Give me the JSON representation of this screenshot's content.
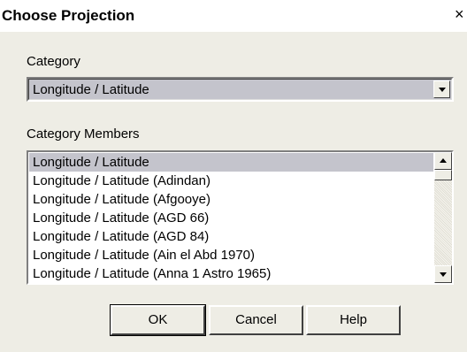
{
  "window": {
    "title": "Choose Projection",
    "close_label": "×"
  },
  "category": {
    "label": "Category",
    "selected_value": "Longitude / Latitude"
  },
  "members": {
    "label": "Category Members",
    "items": [
      "Longitude / Latitude",
      "Longitude / Latitude (Adindan)",
      "Longitude / Latitude (Afgooye)",
      "Longitude / Latitude (AGD 66)",
      "Longitude / Latitude (AGD 84)",
      "Longitude / Latitude (Ain el Abd 1970)",
      "Longitude / Latitude (Anna 1 Astro 1965)"
    ],
    "selected_index": 0
  },
  "buttons": {
    "ok": "OK",
    "cancel": "Cancel",
    "help": "Help"
  },
  "colors": {
    "dialog_background": "#eeede5",
    "selection_background": "#c4c4cc"
  },
  "icons": {
    "combo_arrow": "chevron-down-icon",
    "scroll_up": "arrow-up-icon",
    "scroll_down": "arrow-down-icon"
  }
}
